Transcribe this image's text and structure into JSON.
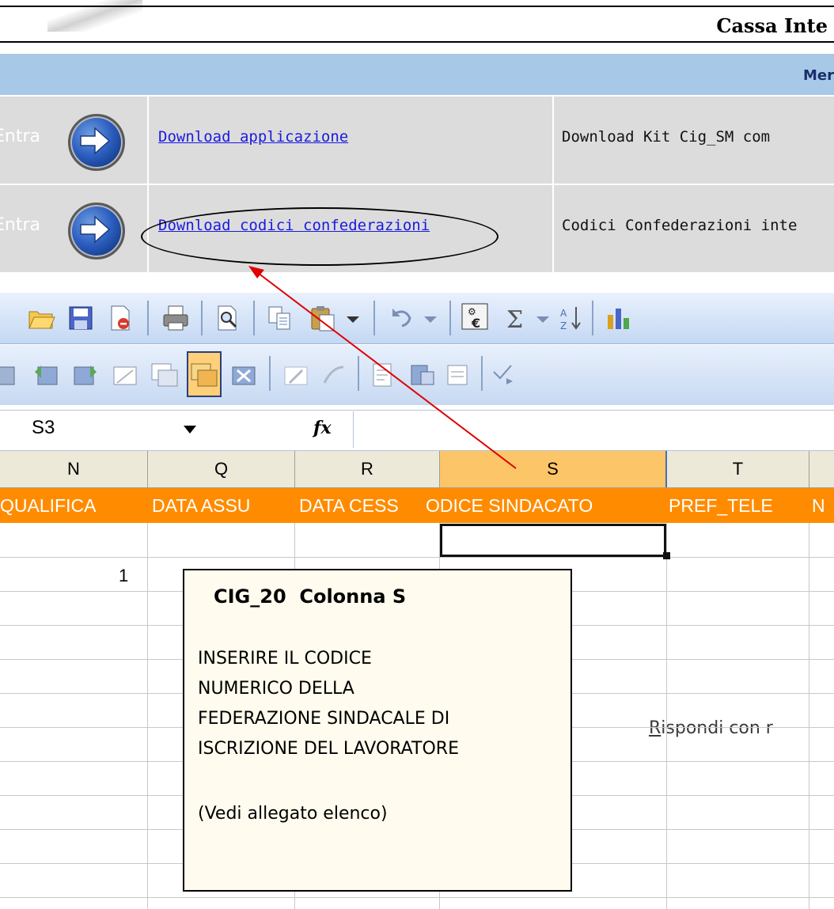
{
  "web_page": {
    "title": "Cassa Inte",
    "menu_label": "Mer",
    "rows": [
      {
        "entra_label": "Entra",
        "link": "Download applicazione",
        "description": "Download Kit Cig_SM com"
      },
      {
        "entra_label": "Entra",
        "link": "Download codici confederazioni",
        "description": "Codici Confederazioni inte"
      }
    ]
  },
  "excel": {
    "toolbar2": {
      "reply_prefix": "R",
      "reply_rest": "ispondi con r"
    },
    "formula_bar": {
      "name_box": "S3",
      "fx_label": "fx",
      "formula": ""
    },
    "columns": [
      {
        "letter": "N"
      },
      {
        "letter": "Q"
      },
      {
        "letter": "R"
      },
      {
        "letter": "S"
      },
      {
        "letter": "T"
      }
    ],
    "header_row": [
      "QUALIFICA",
      "DATA ASSU",
      "DATA CESS",
      "ODICE SINDACATO",
      "PREF_TELE",
      "N"
    ],
    "cell_values": {
      "n_row2": "1"
    },
    "comment": {
      "title": "CIG_20  Colonna S",
      "lines": [
        "INSERIRE IL CODICE",
        "NUMERICO DELLA",
        "FEDERAZIONE SINDACALE DI",
        "ISCRIZIONE DEL LAVORATORE",
        "",
        "(Vedi allegato elenco)"
      ]
    }
  },
  "colors": {
    "menu_bar": "#a8c8e8",
    "row_bg": "#dcdcdc",
    "link": "#1a1adf",
    "orange_header": "#ff8c00",
    "active_column": "#fcc567",
    "comment_bg": "#fffbee",
    "annotation_arrow": "#e00000"
  }
}
